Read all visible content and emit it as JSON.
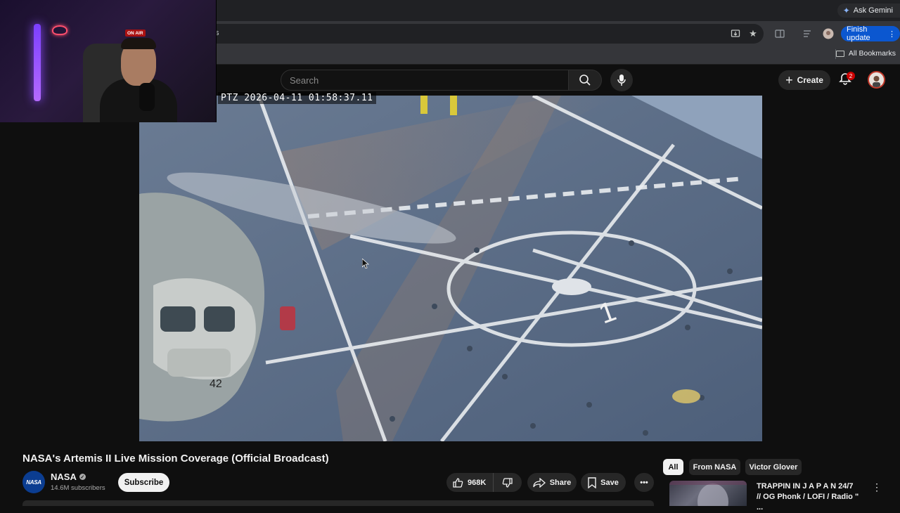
{
  "browser": {
    "gemini_label": "Ask Gemini",
    "omnibox_partial": "s",
    "finish_update_label": "Finish update",
    "bookmarks_label": "All Bookmarks"
  },
  "yt_header": {
    "search_placeholder": "Search",
    "create_label": "Create",
    "notifications_count": "2"
  },
  "webcam": {
    "on_air_label": "ON AIR"
  },
  "video": {
    "timestamp": "PTZ 2026-04-11 01:58:37.11",
    "tail_number": "42",
    "deck_marking": "1"
  },
  "watch": {
    "title": "NASA's Artemis II Live Mission Coverage (Official Broadcast)",
    "channel_name": "NASA",
    "channel_avatar_text": "NASA",
    "subscribers": "14.6M subscribers",
    "subscribe_label": "Subscribe",
    "like_count": "968K",
    "share_label": "Share",
    "save_label": "Save"
  },
  "sidebar": {
    "chips": [
      "All",
      "From NASA",
      "Victor Glover"
    ],
    "active_chip": "All",
    "recommendation": {
      "title_line1": "TRAPPIN IN J A P A N 24/7",
      "title_line2": "// OG Phonk / LOFI / Radio \" ..."
    }
  },
  "colors": {
    "page_bg": "#0f0f0f",
    "brand_blue": "#0b57d0",
    "notification_red": "#cc0000",
    "nasa_blue": "#0b3d91"
  }
}
